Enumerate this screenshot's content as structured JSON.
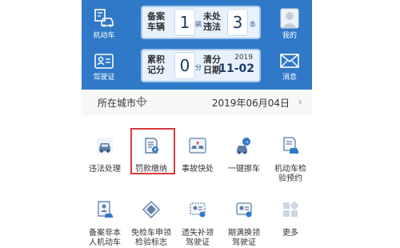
{
  "header": {
    "left_top_label": "机动车",
    "left_bottom_label": "驾驶证",
    "right_top_label": "我的",
    "right_bottom_label": "消息"
  },
  "stats": {
    "vehicles": {
      "label_line1": "备案",
      "label_line2": "车辆",
      "count": "1",
      "unit": "辆"
    },
    "violations": {
      "label_line1": "未处",
      "label_line2": "违法",
      "count": "3",
      "unit": "条"
    },
    "points": {
      "label_line1": "累积",
      "label_line2": "记分",
      "count": "0",
      "unit": "分"
    },
    "clear_date": {
      "label_line1": "清分",
      "label_line2": "日期",
      "year": "2019",
      "date": "11-02"
    }
  },
  "city": {
    "label": "所在城市",
    "date": "2019年06月04日",
    "chevron": "›"
  },
  "services": [
    {
      "icon": "car-icon",
      "label_lines": [
        "违法处理"
      ]
    },
    {
      "icon": "receipt-icon",
      "label_lines": [
        "罚款缴纳"
      ],
      "highlighted": true
    },
    {
      "icon": "accident-icon",
      "label_lines": [
        "事故快处"
      ]
    },
    {
      "icon": "car-move-icon",
      "label_lines": [
        "一键挪车"
      ]
    },
    {
      "icon": "inspection-icon",
      "label_lines": [
        "机动车检",
        "验预约"
      ]
    },
    {
      "icon": "registration-icon",
      "label_lines": [
        "备案非本",
        "人机动车"
      ]
    },
    {
      "icon": "exempt-badge-icon",
      "label_lines": [
        "免检车申领",
        "检验标志"
      ]
    },
    {
      "icon": "reissue-license-icon",
      "label_lines": [
        "遗失补领",
        "驾驶证"
      ]
    },
    {
      "icon": "renew-license-icon",
      "label_lines": [
        "期满换领",
        "驾驶证"
      ]
    },
    {
      "icon": "more-icon",
      "label_lines": [
        "更多"
      ]
    }
  ],
  "colors": {
    "header_blue": "#2f79c8",
    "highlight_red": "#d93a3a"
  }
}
